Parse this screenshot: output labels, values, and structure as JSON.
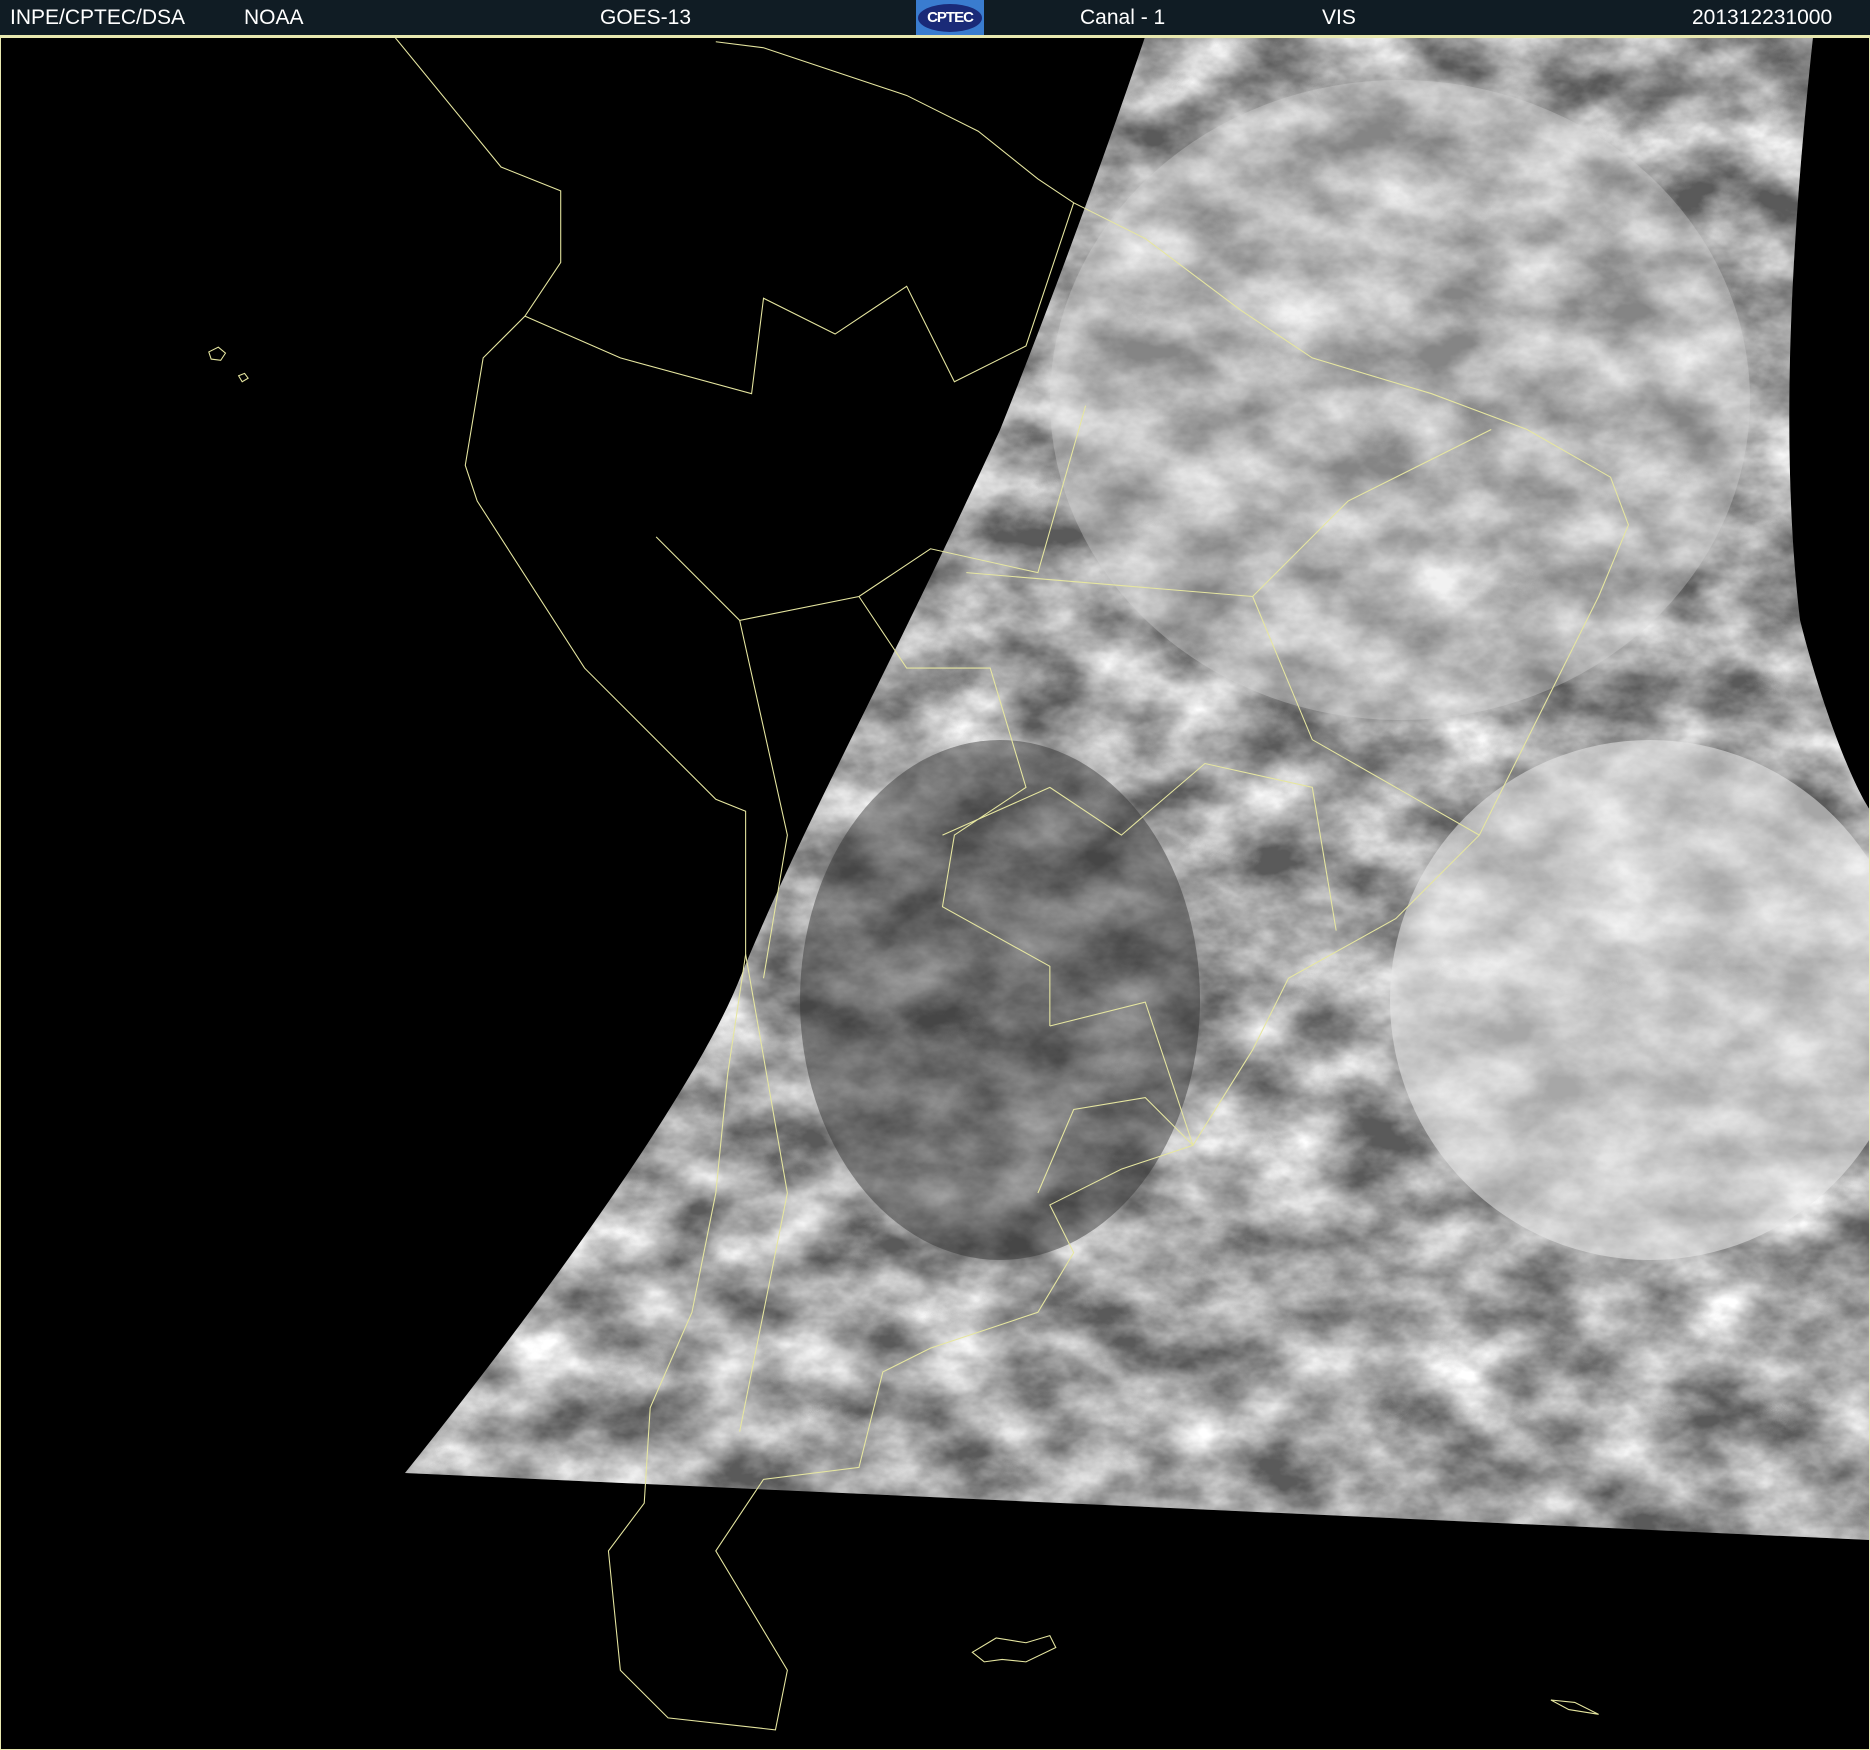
{
  "header": {
    "institution": "INPE/CPTEC/DSA",
    "agency": "NOAA",
    "satellite": "GOES-13",
    "logo_text": "CPTEC",
    "channel": "Canal - 1",
    "band": "VIS",
    "timestamp": "201312231000"
  },
  "colors": {
    "header_bg": "#101c24",
    "border": "#e8e8b0",
    "coastline": "#e6e6a0",
    "background": "#000000"
  }
}
